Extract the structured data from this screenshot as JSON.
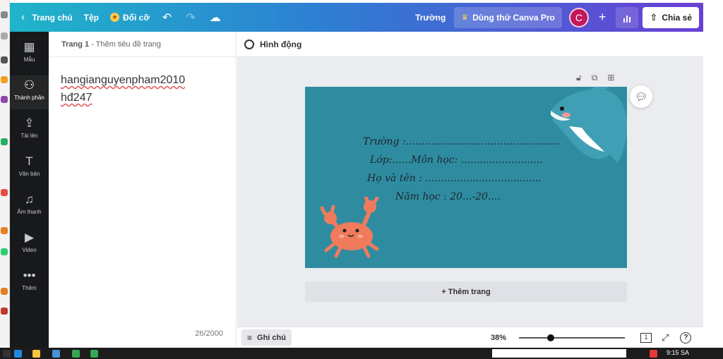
{
  "topbar": {
    "home": "Trang chủ",
    "file": "Tệp",
    "resize": "Đổi cỡ",
    "school": "Trường",
    "trial": "Dùng thử Canva Pro",
    "avatar_initial": "C",
    "share": "Chia sẻ"
  },
  "sidebar": {
    "items": [
      {
        "label": "Mẫu",
        "icon": "▦"
      },
      {
        "label": "Thành phần",
        "icon": "⚇"
      },
      {
        "label": "Tải lên",
        "icon": "⇪"
      },
      {
        "label": "Văn bản",
        "icon": "T"
      },
      {
        "label": "Âm thanh",
        "icon": "♫"
      },
      {
        "label": "Video",
        "icon": "▶"
      },
      {
        "label": "Thêm",
        "icon": "•••"
      }
    ]
  },
  "notes": {
    "page_label": "Trang 1",
    "page_hint": "- Thêm tiêu đề trang",
    "lines": [
      "hangianguyenpham2010",
      "hđ247"
    ],
    "char_count": "26/2000"
  },
  "toolbar": {
    "animate": "Hình động"
  },
  "slide": {
    "background": "#2f8ca0",
    "lines": [
      "Trường :.................................................",
      "Lớp:......Môn học: ..........................",
      "Họ và tên : .....................................",
      "Năm học : 20...-20...."
    ]
  },
  "workspace": {
    "add_page": "+ Thêm trang"
  },
  "bottombar": {
    "notes": "Ghi chú",
    "zoom": "38%",
    "zoom_fraction": 0.3,
    "page_count": "1"
  },
  "taskbar": {
    "clock": "9:15 SA"
  }
}
